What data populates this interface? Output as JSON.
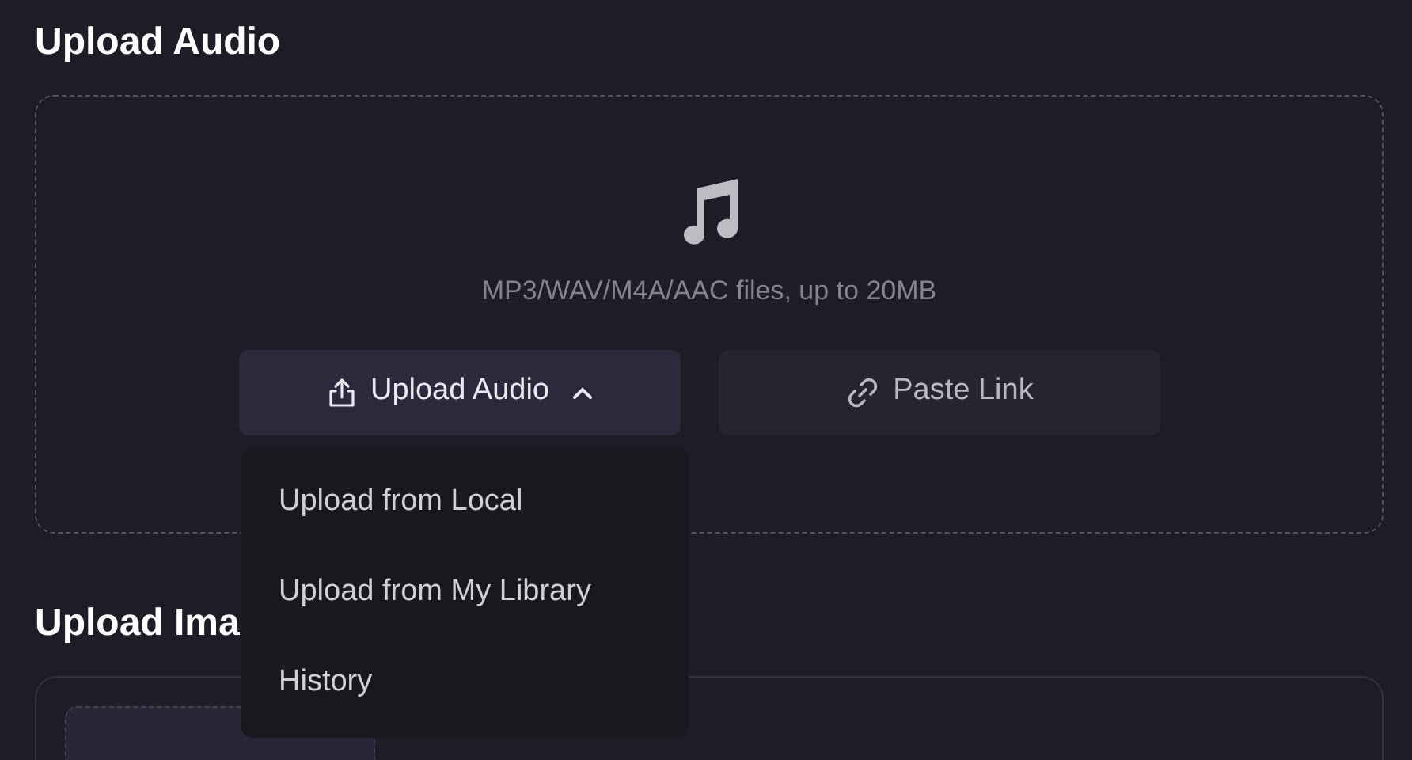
{
  "audio_section": {
    "title": "Upload Audio",
    "hint": "MP3/WAV/M4A/AAC files, up to 20MB",
    "buttons": [
      {
        "kind": "upload",
        "label": "Upload Audio",
        "expanded": true
      },
      {
        "kind": "link",
        "label": "Paste Link"
      }
    ],
    "menu": [
      {
        "label": "Upload from Local"
      },
      {
        "label": "Upload from My Library"
      },
      {
        "label": "History"
      }
    ]
  },
  "image_section": {
    "title": "Upload Ima"
  }
}
